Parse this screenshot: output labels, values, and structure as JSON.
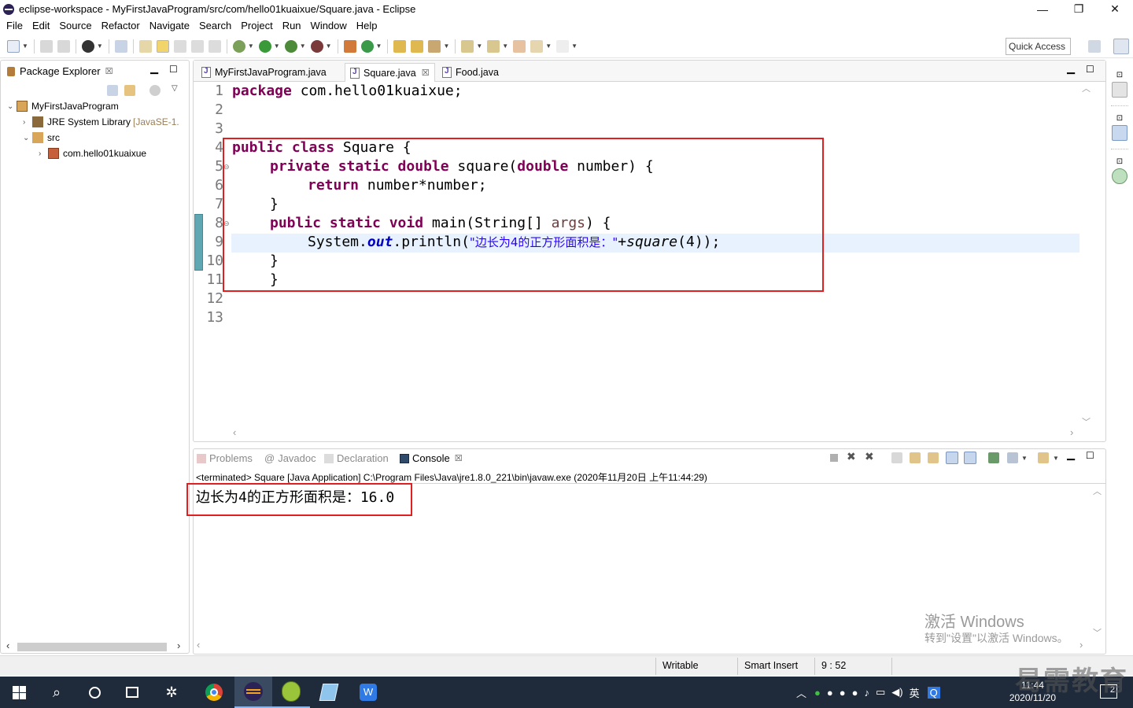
{
  "window": {
    "title": "eclipse-workspace - MyFirstJavaProgram/src/com/hello01kuaixue/Square.java - Eclipse",
    "minimize": "—",
    "restore": "❐",
    "close": "✕"
  },
  "menu": [
    "File",
    "Edit",
    "Source",
    "Refactor",
    "Navigate",
    "Search",
    "Project",
    "Run",
    "Window",
    "Help"
  ],
  "toolbar": {
    "quick_access": "Quick Access"
  },
  "package_explorer": {
    "title": "Package Explorer",
    "tree": [
      {
        "label": "MyFirstJavaProgram",
        "twisty": "⌄"
      },
      {
        "label": "JRE System Library",
        "decor": "[JavaSE-1.",
        "twisty": "›"
      },
      {
        "label": "src",
        "twisty": "⌄"
      },
      {
        "label": "com.hello01kuaixue",
        "twisty": "›"
      }
    ]
  },
  "editor": {
    "tabs": [
      {
        "label": "MyFirstJavaProgram.java"
      },
      {
        "label": "Square.java",
        "active": true
      },
      {
        "label": "Food.java"
      }
    ],
    "line_numbers": [
      "1",
      "2",
      "3",
      "4",
      "5",
      "6",
      "7",
      "8",
      "9",
      "10",
      "11",
      "12",
      "13"
    ],
    "code": {
      "l1_kw": "package",
      "l1_rest": " com.hello01kuaixue;",
      "l4_kw": "public class",
      "l4_rest": " Square {",
      "l5_kw": "private static double",
      "l5_rest": " square(",
      "l5_kw2": "double",
      "l5_rest2": " number) {",
      "l6_kw": "return",
      "l6_rest": " number*number;",
      "l7": "}",
      "l8_kw": "public static void",
      "l8_rest": " main(String[] ",
      "l8_arg": "args",
      "l8_end": ") {",
      "l9_a": "System.",
      "l9_field": "out",
      "l9_b": ".println(",
      "l9_str": "\"边长为4的正方形面积是：\"",
      "l9_c": "+",
      "l9_call": "square",
      "l9_d": "(4));",
      "l10": "}",
      "l11": "}"
    }
  },
  "console": {
    "tabs": [
      {
        "label": "Problems"
      },
      {
        "label": "Javadoc"
      },
      {
        "label": "Declaration"
      },
      {
        "label": "Console",
        "active": true
      }
    ],
    "status": "<terminated> Square [Java Application] C:\\Program Files\\Java\\jre1.8.0_221\\bin\\javaw.exe (2020年11月20日 上午11:44:29)",
    "output": "边长为4的正方形面积是：16.0",
    "activate_title": "激活 Windows",
    "activate_sub": "转到\"设置\"以激活 Windows。"
  },
  "statusbar": {
    "writable": "Writable",
    "insert_mode": "Smart Insert",
    "position": "9 : 52"
  },
  "taskbar": {
    "ime": "英",
    "time": "11:44",
    "date": "2020/11/20",
    "notifications": "2",
    "watermark": "曷需教育"
  },
  "colors": {
    "keyword": "#7f0055",
    "string": "#2a00ff",
    "field": "#0000c0",
    "highlight_box": "#e02020",
    "current_line": "#e8f2fe",
    "taskbar": "#1f2a3a"
  }
}
